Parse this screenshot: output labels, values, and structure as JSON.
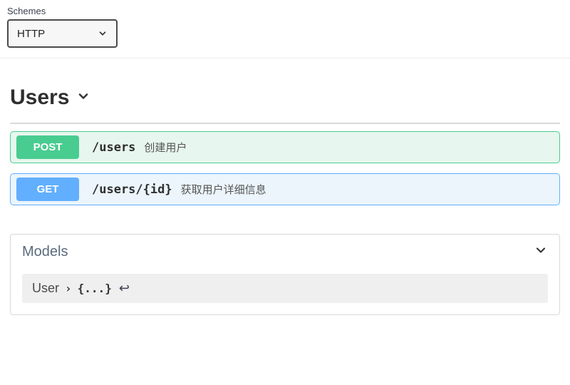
{
  "schemes": {
    "label": "Schemes",
    "selected": "HTTP"
  },
  "tag": {
    "name": "Users"
  },
  "operations": [
    {
      "method": "POST",
      "method_class": "post",
      "path": "/users",
      "summary": "创建用户"
    },
    {
      "method": "GET",
      "method_class": "get",
      "path": "/users/{id}",
      "summary": "获取用户详细信息"
    }
  ],
  "models": {
    "title": "Models",
    "items": [
      {
        "name": "User",
        "collapsed_repr": "{...}"
      }
    ]
  }
}
